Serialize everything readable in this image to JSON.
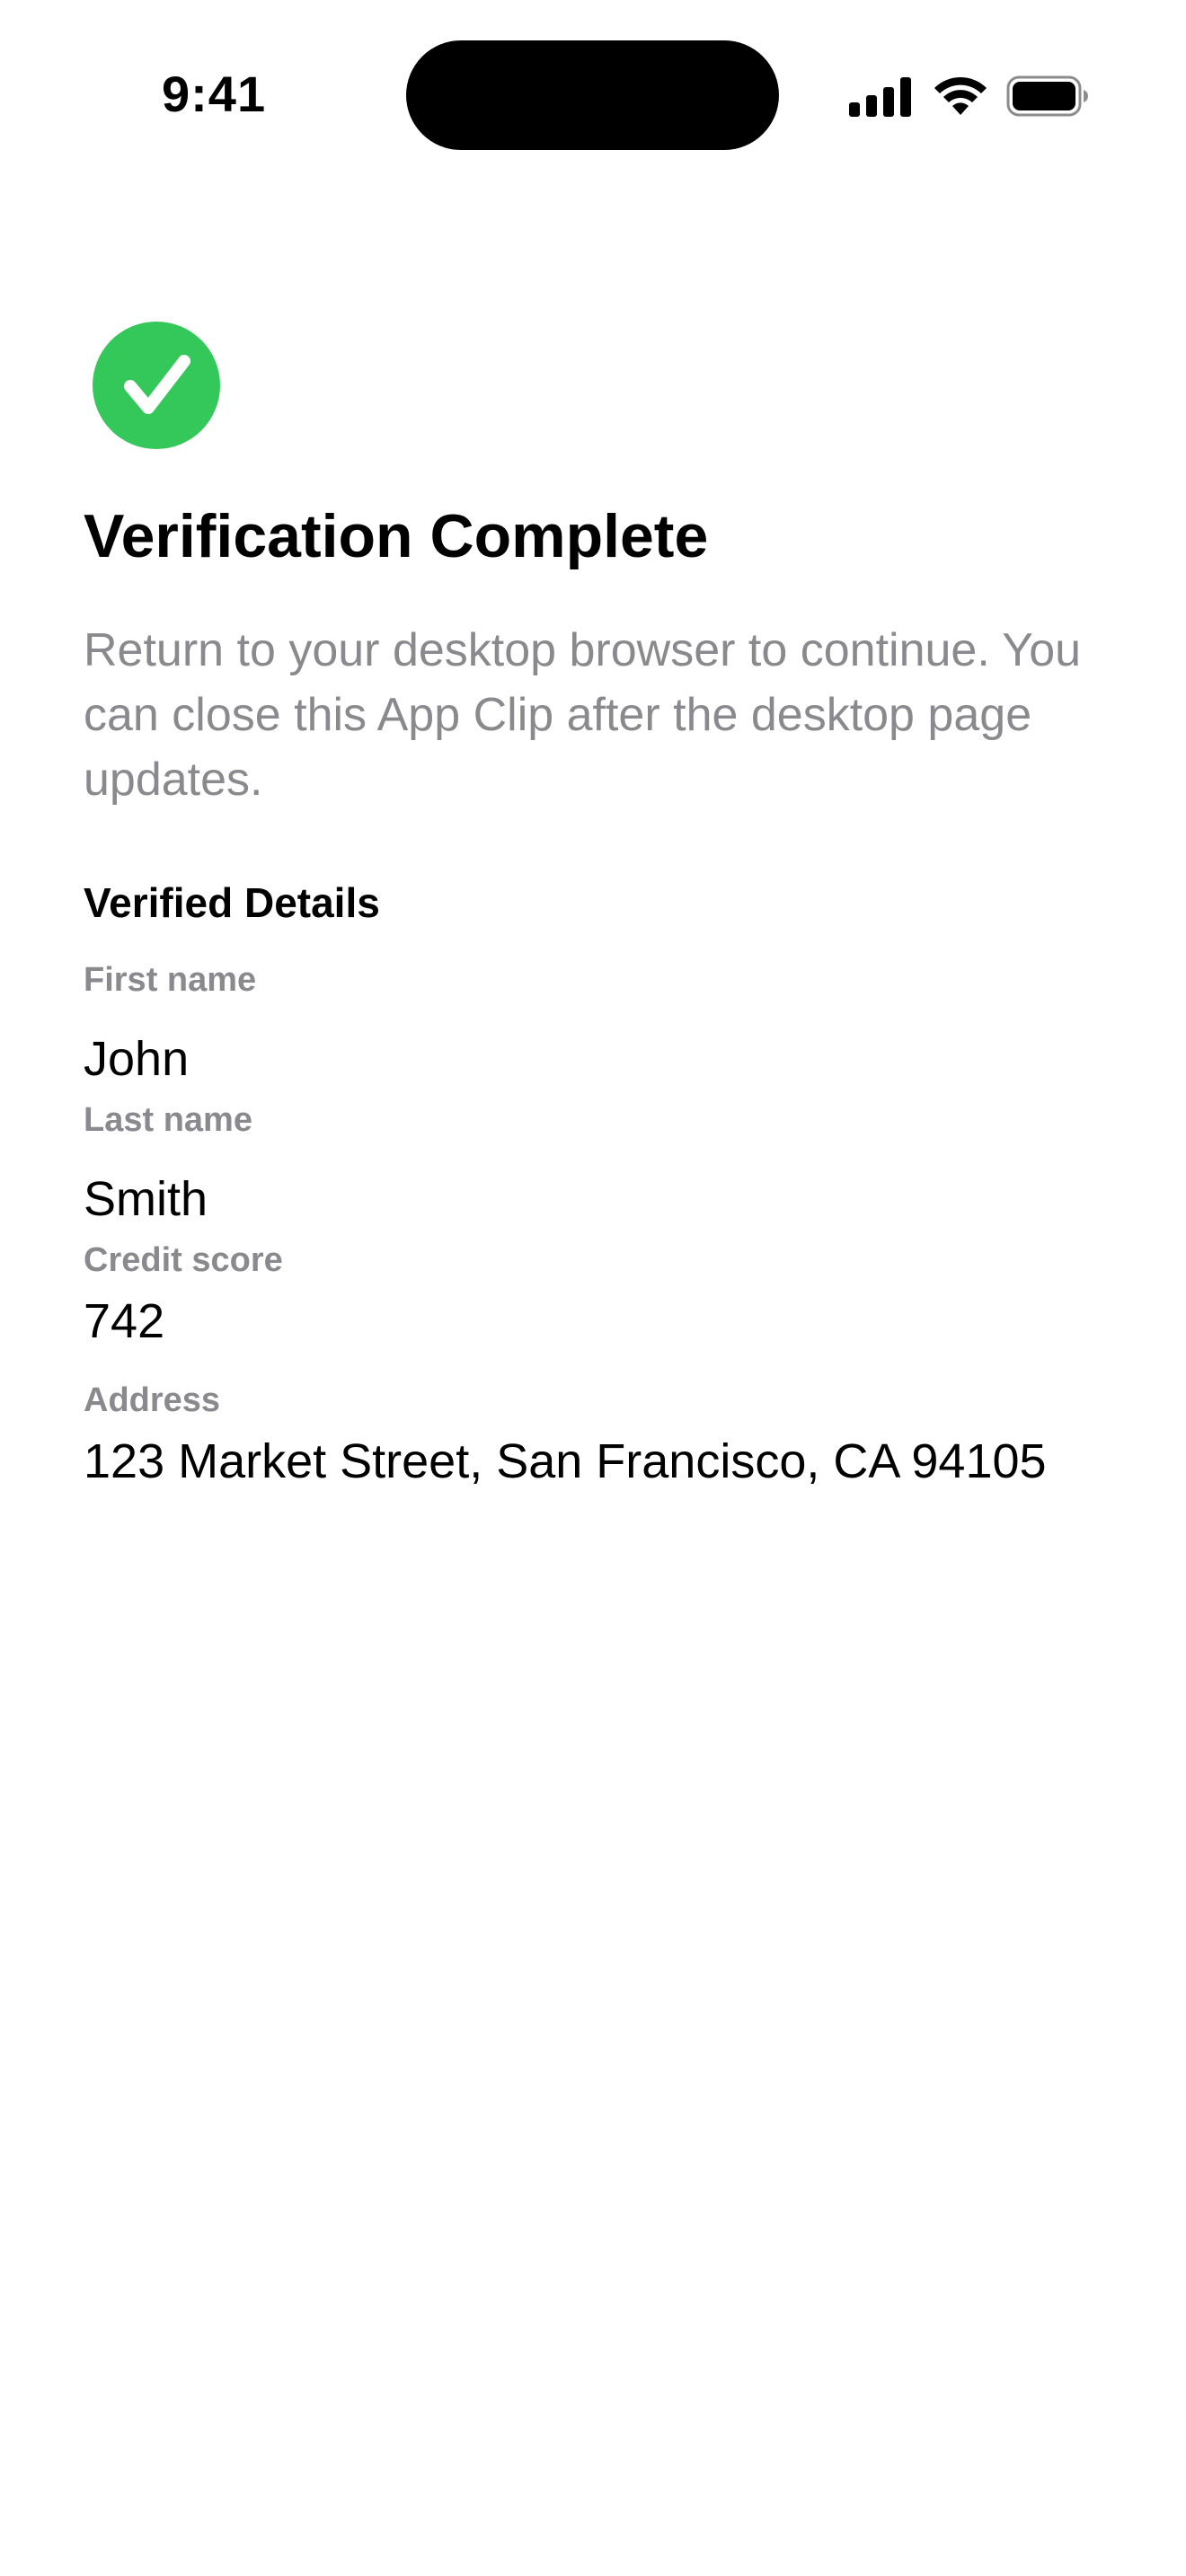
{
  "status_bar": {
    "time": "9:41",
    "icons": [
      "signal-icon",
      "wifi-icon",
      "battery-icon"
    ]
  },
  "main": {
    "icon": "checkmark-circle-icon",
    "icon_color": "#34C759",
    "title": "Verification Complete",
    "subtitle": "Return to your desktop browser to continue. You can close this App Clip after the desktop page updates."
  },
  "details": {
    "heading": "Verified Details",
    "fields": [
      {
        "label": "First name",
        "value": "John"
      },
      {
        "label": "Last name",
        "value": "Smith"
      },
      {
        "label": "Credit score",
        "value": "742"
      },
      {
        "label": "Address",
        "value": "123 Market Street, San Francisco, CA 94105"
      }
    ]
  }
}
